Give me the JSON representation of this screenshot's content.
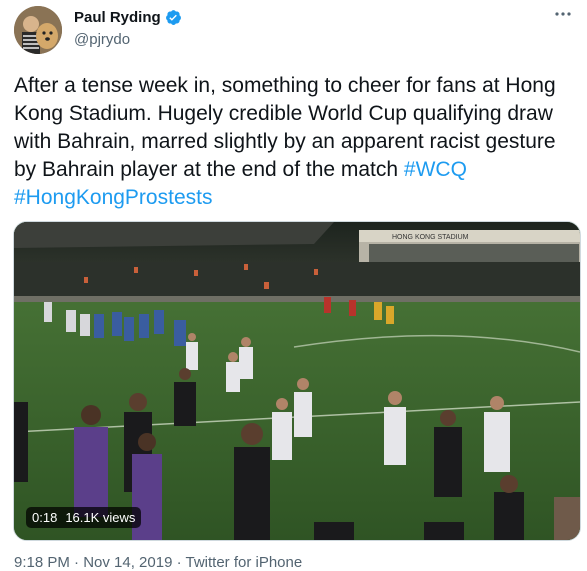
{
  "author": {
    "display_name": "Paul Ryding",
    "handle": "@pjrydo",
    "verified_icon": "verified-badge-icon",
    "verified_color": "#1d9bf0"
  },
  "tweet": {
    "text_before": "After a tense week in, something to cheer for fans at Hong Kong Stadium. Hugely credible World Cup qualifying draw with Bahrain, marred slightly by an apparent racist gesture by Bahrain player at the end of the match ",
    "hashtags": [
      "#WCQ",
      "#HongKongProstests"
    ],
    "hashtag_color": "#1d9bf0"
  },
  "media": {
    "stadium_sign": "HONG KONG STADIUM",
    "duration": "0:18",
    "views": "16.1K views"
  },
  "footer": {
    "meta": "9:18 PM · Nov 14, 2019 · Twitter for iPhone"
  }
}
